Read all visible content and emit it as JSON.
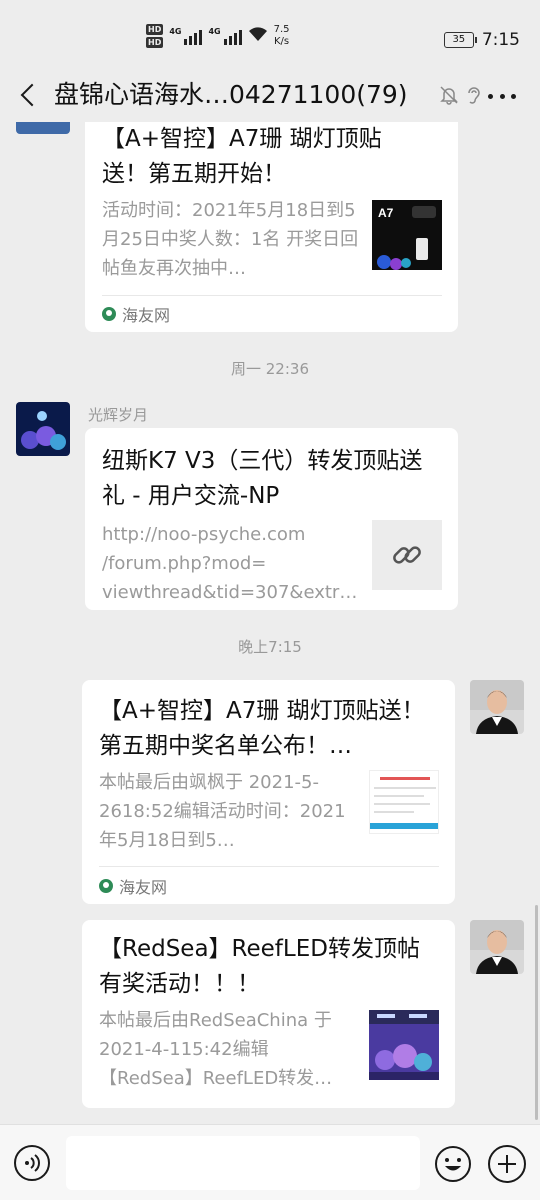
{
  "status_bar": {
    "hd1": "HD",
    "hd2": "HD",
    "net1": "4G",
    "net2": "4G",
    "speed_value": "7.5",
    "speed_unit": "K/s",
    "battery": "35",
    "time": "7:15"
  },
  "header": {
    "title": "盘锦心语海水…04271100(79)"
  },
  "messages": [
    {
      "title": "【A+智控】A7珊 瑚灯顶贴送！第五期开始！",
      "desc": "活动时间：2021年5月18日到5月25日中奖人数：1名 开奖日回帖鱼友再次抽中…",
      "thumb_label": "A7",
      "source": "海友网"
    },
    {
      "timestamp": "周一 22:36",
      "sender": "光辉岁月",
      "title": "纽斯K7 V3（三代）转发顶贴送礼 - 用户交流-NP",
      "desc": "http://noo-psyche.com /forum.php?mod= viewthread&tid=307&extr…"
    },
    {
      "timestamp": "晚上7:15",
      "title": "【A+智控】A7珊 瑚灯顶贴送！第五期中奖名单公布！…",
      "desc": "本帖最后由飒枫于 2021-5-2618:52编辑活动时间：2021年5月18日到5…",
      "source": "海友网"
    },
    {
      "title": "【RedSea】ReefLED转发顶帖有奖活动！！！",
      "desc": "本帖最后由RedSeaChina 于2021-4-115:42编辑 【RedSea】ReefLED转发…"
    }
  ],
  "colors": {
    "background": "#ededed",
    "bubble": "#ffffff",
    "muted_text": "#9a9a9a"
  }
}
